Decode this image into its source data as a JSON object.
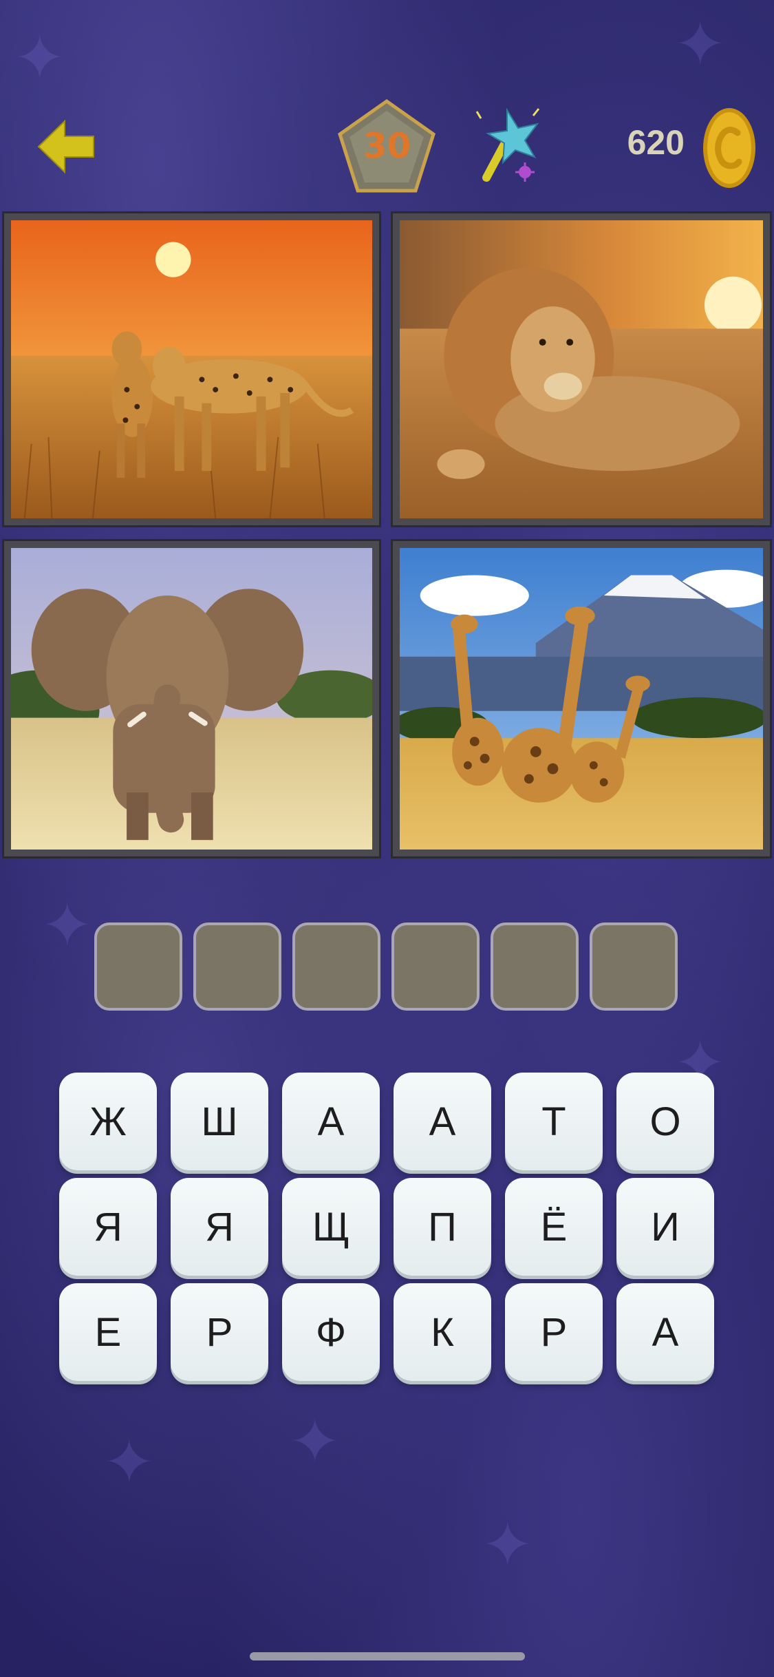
{
  "header": {
    "level": "30",
    "coins": "620"
  },
  "photos": [
    {
      "subject": "cheetahs at sunset"
    },
    {
      "subject": "lion in grass"
    },
    {
      "subject": "elephant"
    },
    {
      "subject": "giraffes"
    }
  ],
  "answer": {
    "slots": [
      "",
      "",
      "",
      "",
      "",
      ""
    ]
  },
  "keyboard": {
    "letters": [
      "Ж",
      "Ш",
      "А",
      "А",
      "Т",
      "О",
      "Я",
      "Я",
      "Щ",
      "П",
      "Ё",
      "И",
      "Е",
      "Р",
      "Ф",
      "К",
      "Р",
      "А"
    ]
  },
  "colors": {
    "background": "#2a2566",
    "level_text": "#e0762a",
    "coin_gold": "#e8b522",
    "back_arrow": "#d4c21c",
    "slot_fill": "#7b7565",
    "key_fill": "#eef3f4"
  }
}
